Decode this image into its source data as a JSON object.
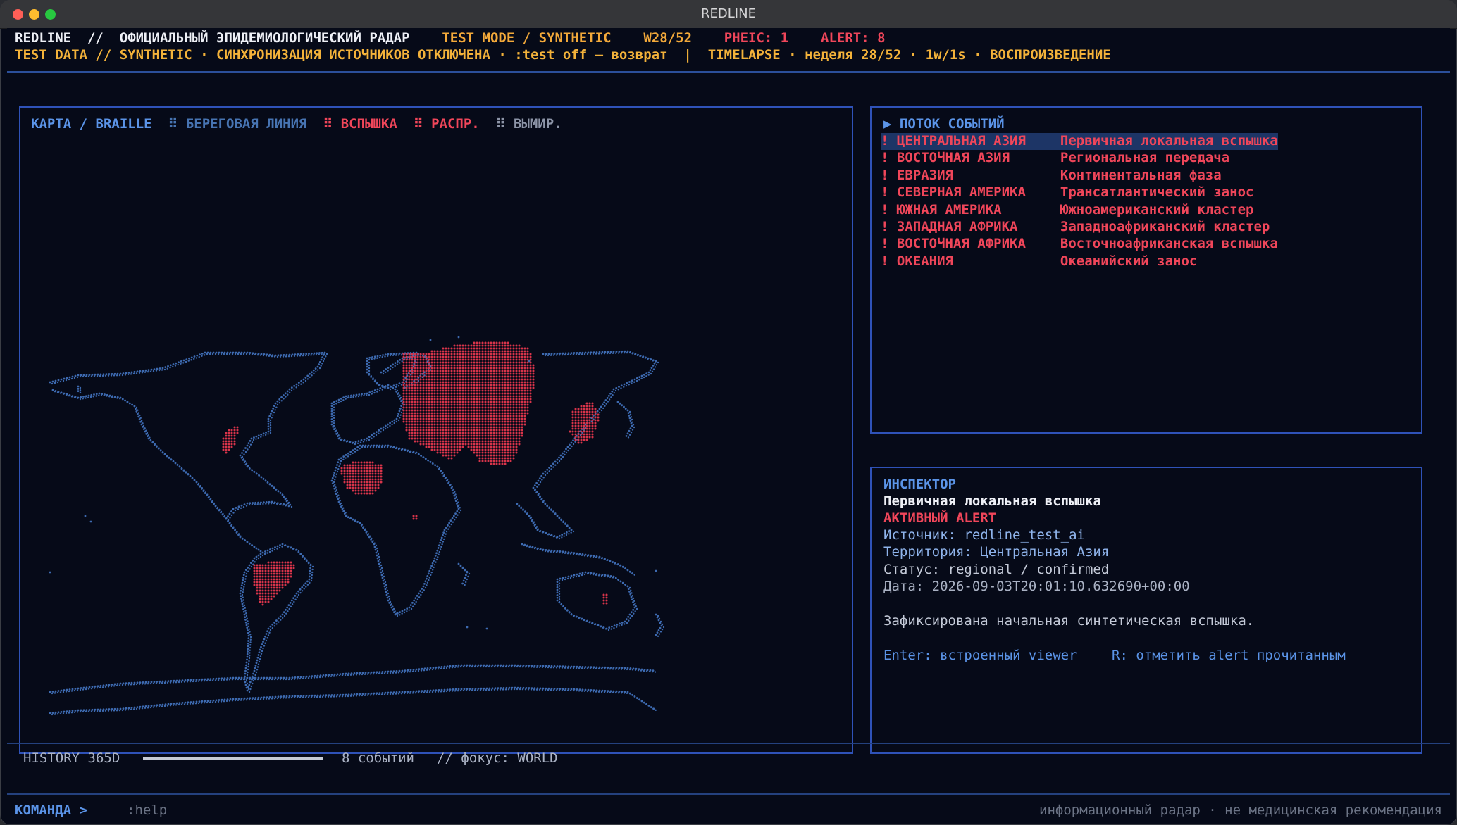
{
  "window": {
    "title": "REDLINE"
  },
  "header": {
    "brand": "REDLINE",
    "sep": "//",
    "subtitle": "ОФИЦИАЛЬНЫЙ ЭПИДЕМИОЛОГИЧЕСКИЙ РАДАР",
    "mode": "TEST MODE / SYNTHETIC",
    "week": "W28/52",
    "pheic": "PHEIC: 1",
    "alert": "ALERT: 8",
    "status_line": "TEST DATA // SYNTHETIC · СИНХРОНИЗАЦИЯ ИСТОЧНИКОВ ОТКЛЮЧЕНА · :test off — возврат  |  TIMELAPSE · неделя 28/52 · 1w/1s · ВОСПРОИЗВЕДЕНИЕ"
  },
  "map": {
    "title": "КАРТА / BRAILLE",
    "legend": [
      {
        "glyph": "⠿",
        "label": "БЕРЕГОВАЯ ЛИНИЯ",
        "color": "#4774b2"
      },
      {
        "glyph": "⠿",
        "label": "ВСПЫШКА",
        "color": "#f0465a"
      },
      {
        "glyph": "⠿",
        "label": "РАСПР.",
        "color": "#e0434f"
      },
      {
        "glyph": "⠿",
        "label": "ВЫМИР.",
        "color": "#8d95a8"
      }
    ],
    "colors": {
      "coast": "#3d6ab0",
      "outbreak": "#d8344a"
    }
  },
  "events": {
    "title": "▶ ПОТОК СОБЫТИЙ",
    "items": [
      {
        "mark": "!",
        "region": "ЦЕНТРАЛЬНАЯ АЗИЯ",
        "desc": "Первичная локальная вспышка",
        "selected": true
      },
      {
        "mark": "!",
        "region": "ВОСТОЧНАЯ АЗИЯ",
        "desc": "Региональная передача",
        "selected": false
      },
      {
        "mark": "!",
        "region": "ЕВРАЗИЯ",
        "desc": "Континентальная фаза",
        "selected": false
      },
      {
        "mark": "!",
        "region": "СЕВЕРНАЯ АМЕРИКА",
        "desc": "Трансатлантический занос",
        "selected": false
      },
      {
        "mark": "!",
        "region": "ЮЖНАЯ АМЕРИКА",
        "desc": "Южноамериканский кластер",
        "selected": false
      },
      {
        "mark": "!",
        "region": "ЗАПАДНАЯ АФРИКА",
        "desc": "Западноафриканский кластер",
        "selected": false
      },
      {
        "mark": "!",
        "region": "ВОСТОЧНАЯ АФРИКА",
        "desc": "Восточноафриканская вспышка",
        "selected": false
      },
      {
        "mark": "!",
        "region": "ОКЕАНИЯ",
        "desc": "Океанийский занос",
        "selected": false
      }
    ]
  },
  "inspector": {
    "title": "ИНСПЕКТОР",
    "event_title": "Первичная локальная вспышка",
    "alert_state": "АКТИВНЫЙ ALERT",
    "source": "Источник: redline_test_ai",
    "territory": "Территория: Центральная Азия",
    "status": "Статус: regional / confirmed",
    "date": "Дата: 2026-09-03T20:01:10.632690+00:00",
    "summary": "Зафиксирована начальная синтетическая вспышка.",
    "hint_enter": "Enter: встроенный viewer",
    "hint_r": "R: отметить alert прочитанным"
  },
  "history": {
    "label": "HISTORY 365D",
    "progress": 1.0,
    "events_count": "8 событий",
    "focus": "// фокус: WORLD"
  },
  "command": {
    "prompt": "КОМАНДА >",
    "value": ":help",
    "footer_note": "информационный радар · не медицинская рекомендация"
  }
}
